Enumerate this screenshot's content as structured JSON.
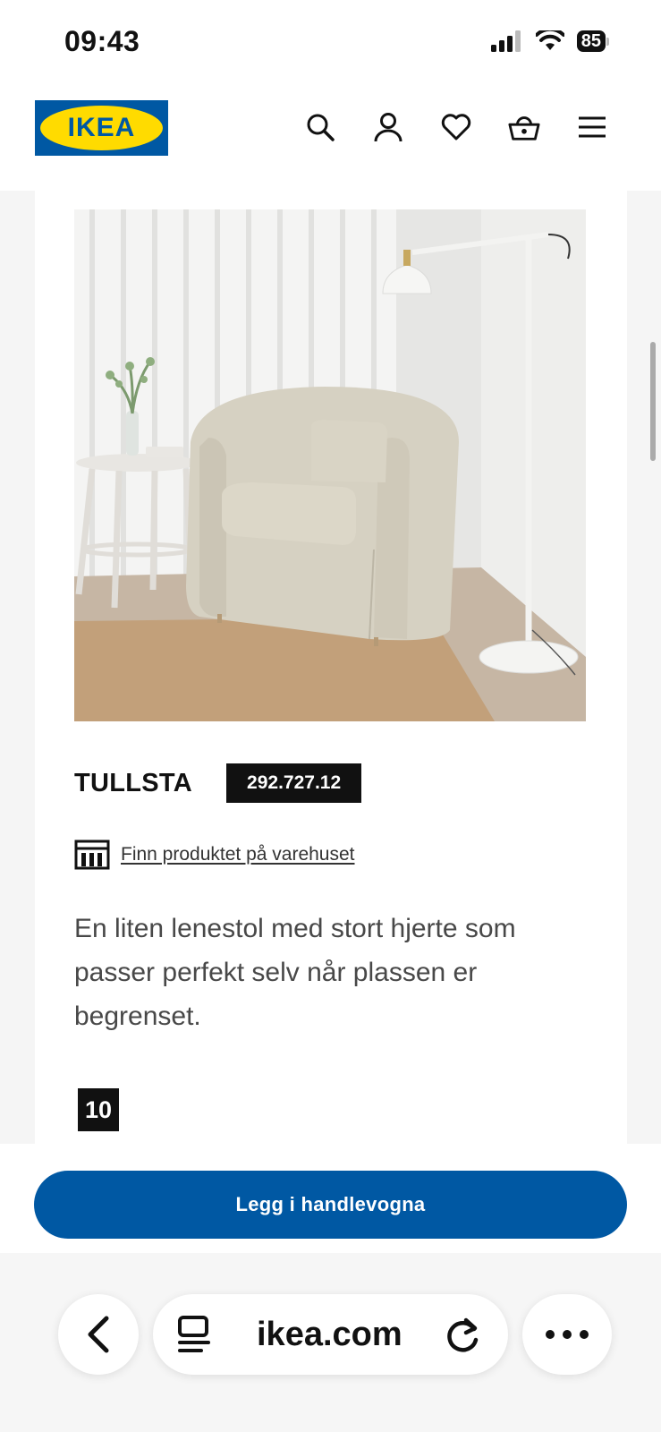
{
  "status_bar": {
    "time": "09:43",
    "battery": "85",
    "icons": [
      "signal-icon",
      "wifi-icon",
      "battery-icon"
    ]
  },
  "header": {
    "logo_text": "IKEA",
    "colors": {
      "brand_blue": "#0058a3",
      "brand_yellow": "#ffdb00"
    },
    "icons": [
      "search-icon",
      "account-icon",
      "heart-icon",
      "basket-icon",
      "menu-icon"
    ]
  },
  "product": {
    "image_alt": "TULLSTA armchair in beige beside side table and floor lamp",
    "name": "TULLSTA",
    "article_number": "292.727.12",
    "store_link": "Finn produktet på varehuset",
    "description": "En liten lenestol med stort hjerte som passer perfekt selv når plassen er begrenset.",
    "badge": "10"
  },
  "cta": {
    "label": "Legg i handlevogna",
    "color": "#0058a3"
  },
  "browser": {
    "url": "ikea.com",
    "icons": [
      "back-icon",
      "reader-icon",
      "reload-icon",
      "more-icon"
    ]
  }
}
